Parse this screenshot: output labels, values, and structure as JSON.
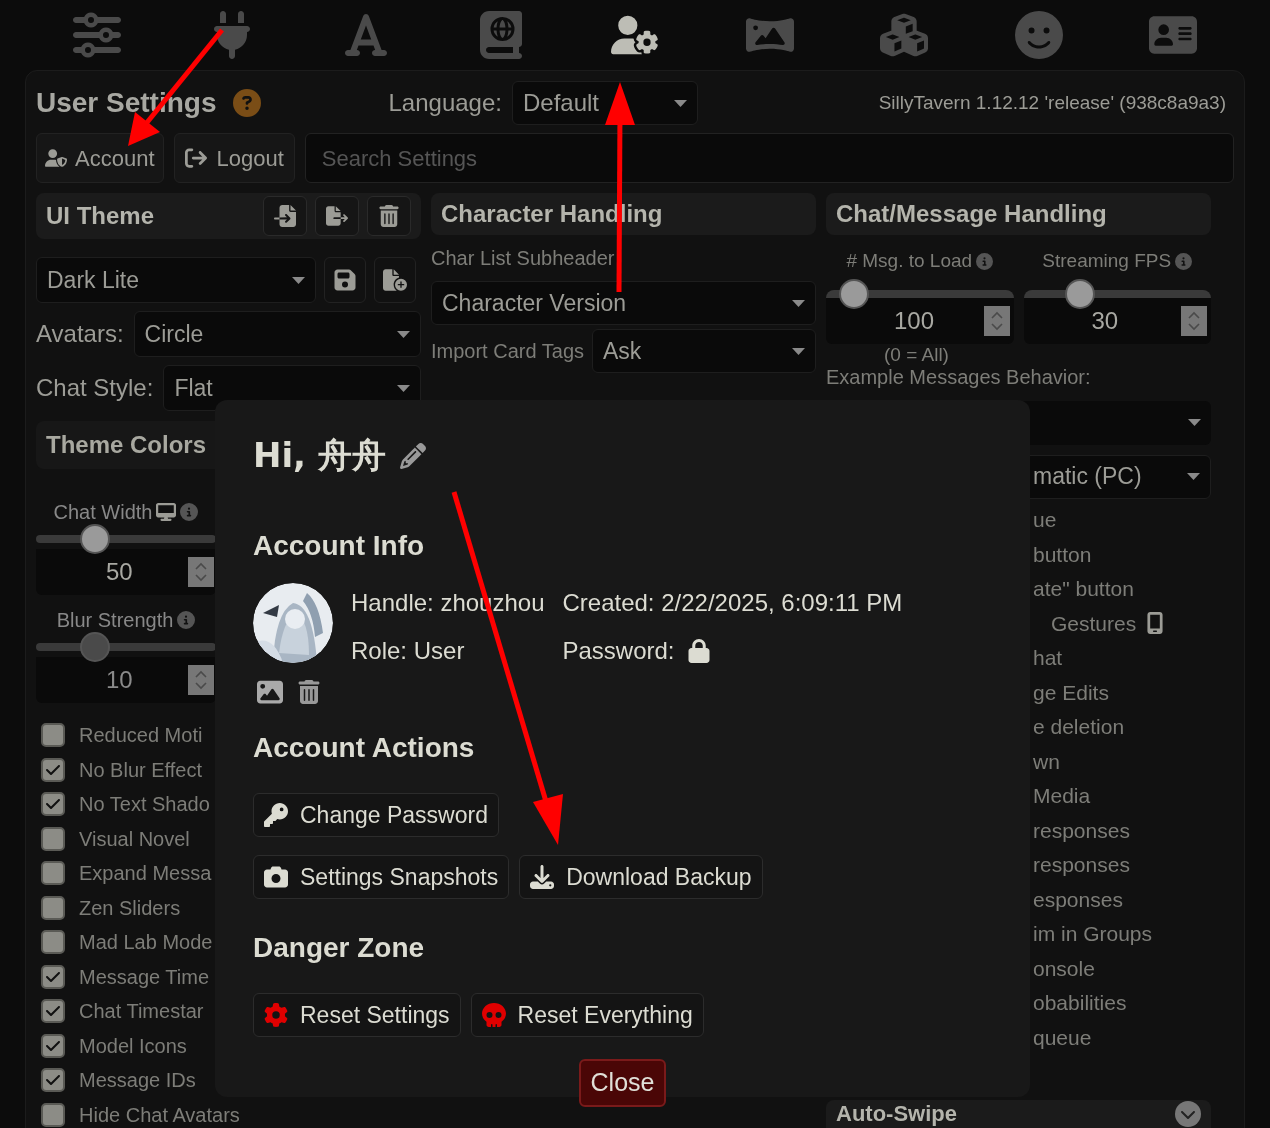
{
  "nav_tabs": [
    {
      "selected": false
    },
    {
      "selected": false
    },
    {
      "selected": false
    },
    {
      "selected": false
    },
    {
      "selected": true
    },
    {
      "selected": false
    },
    {
      "selected": false
    },
    {
      "selected": false
    },
    {
      "selected": false
    }
  ],
  "header": {
    "title": "User Settings",
    "language_label": "Language:",
    "language_value": "Default",
    "version": "SillyTavern 1.12.12 'release' (938c8a9a3)"
  },
  "account_button": "Account",
  "logout_button": "Logout",
  "search": {
    "placeholder": "Search Settings"
  },
  "left": {
    "title": "UI Theme",
    "theme_value": "Dark Lite",
    "avatars_label": "Avatars:",
    "avatars_value": "Circle",
    "chat_style_label": "Chat Style:",
    "chat_style_value": "Flat",
    "theme_colors": "Theme Colors",
    "sliders": [
      {
        "label": "Chat Width",
        "level": 0.33,
        "value": "50",
        "disabled": false,
        "kind": "desktop"
      },
      {
        "label": "Blur Strength",
        "level": 0.33,
        "value": "10",
        "disabled": true,
        "kind": "plain"
      }
    ],
    "checkboxes": [
      {
        "label": "Reduced Moti",
        "checked": false
      },
      {
        "label": "No Blur Effect",
        "checked": true
      },
      {
        "label": "No Text Shado",
        "checked": true
      },
      {
        "label": "Visual Novel",
        "checked": false
      },
      {
        "label": "Expand Messa",
        "checked": false
      },
      {
        "label": "Zen Sliders",
        "checked": false
      },
      {
        "label": "Mad Lab Mode",
        "checked": false
      },
      {
        "label": "Message Time",
        "checked": true
      },
      {
        "label": "Chat Timestar",
        "checked": true
      },
      {
        "label": "Model Icons",
        "checked": true
      },
      {
        "label": "Message IDs",
        "checked": true
      },
      {
        "label": "Hide Chat Avatars",
        "checked": false
      }
    ]
  },
  "middle": {
    "title": "Character Handling",
    "subheader_label": "Char List Subheader",
    "subheader_value": "Character Version",
    "import_label": "Import Card Tags",
    "import_value": "Ask"
  },
  "right": {
    "title": "Chat/Message Handling",
    "sliders": [
      {
        "label": "# Msg. to Load",
        "level": 0.15,
        "value": "100"
      },
      {
        "label": "Streaming FPS",
        "level": 0.3,
        "value": "30"
      }
    ],
    "hint": "(0 = All)",
    "example_label": "Example Messages Behavior:",
    "dropdown_value": "matic (PC)",
    "items": [
      {
        "label": "ue",
        "kind": "plain"
      },
      {
        "label": "button",
        "kind": "plain"
      },
      {
        "label": "ate\" button",
        "kind": "plain"
      },
      {
        "label": "Gestures",
        "kind": "mobile"
      },
      {
        "label": "hat",
        "kind": "plain"
      },
      {
        "label": "ge Edits",
        "kind": "plain"
      },
      {
        "label": "e deletion",
        "kind": "plain"
      },
      {
        "label": "wn",
        "kind": "plain"
      },
      {
        "label": "Media",
        "kind": "plain"
      },
      {
        "label": "responses",
        "kind": "plain"
      },
      {
        "label": "responses",
        "kind": "plain"
      },
      {
        "label": "esponses",
        "kind": "plain"
      },
      {
        "label": "im in Groups",
        "kind": "plain"
      },
      {
        "label": "onsole",
        "kind": "plain"
      },
      {
        "label": "obabilities",
        "kind": "plain"
      },
      {
        "label": "queue",
        "kind": "plain"
      }
    ],
    "footer_title": "Auto-Swipe"
  },
  "dialog": {
    "greeting": "Hi, 舟舟",
    "info_title": "Account Info",
    "handle": "Handle: zhouzhou",
    "role": "Role: User",
    "created": "Created: 2/22/2025, 6:09:11 PM",
    "password_label": "Password:",
    "actions_title": "Account Actions",
    "actions": [
      [
        "Change Password"
      ],
      [
        "Settings Snapshots",
        "Download Backup"
      ]
    ],
    "danger_title": "Danger Zone",
    "danger_actions": [
      "Reset Settings",
      "Reset Everything"
    ],
    "close": "Close"
  }
}
